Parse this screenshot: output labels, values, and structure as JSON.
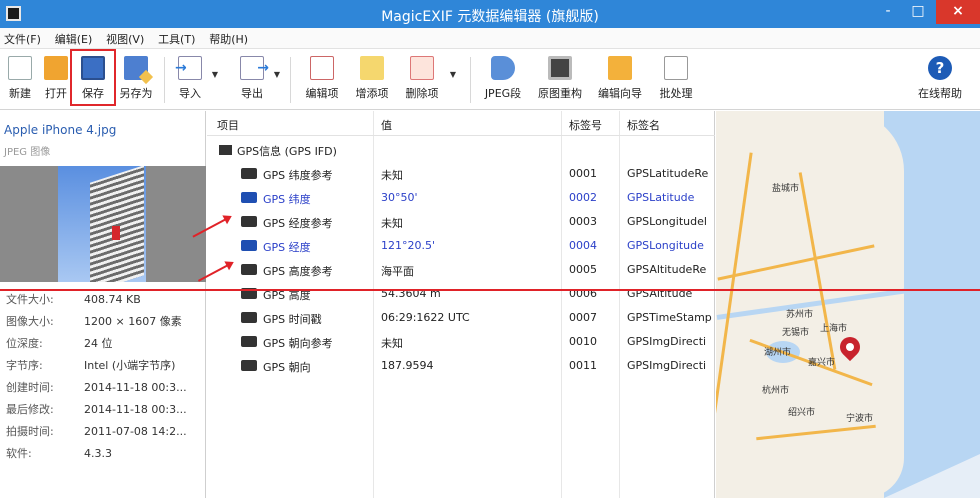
{
  "window": {
    "title": "MagicEXIF 元数据编辑器 (旗舰版)",
    "min": "-",
    "max": "□",
    "close": "×"
  },
  "menu": [
    "文件(F)",
    "编辑(E)",
    "视图(V)",
    "工具(T)",
    "帮助(H)"
  ],
  "toolbar": {
    "new": "新建",
    "open": "打开",
    "save": "保存",
    "saveas": "另存为",
    "import": "导入",
    "export": "导出",
    "edit": "编辑项",
    "add": "增添项",
    "delete": "删除项",
    "jpeg": "JPEG段",
    "raw": "原图重构",
    "wizard": "编辑向导",
    "batch": "批处理",
    "help": "在线帮助",
    "help_glyph": "?"
  },
  "file": {
    "name": "Apple iPhone 4.jpg",
    "type": "JPEG 图像",
    "props": [
      {
        "k": "文件大小:",
        "v": "408.74 KB"
      },
      {
        "k": "图像大小:",
        "v": "1200 × 1607 像素"
      },
      {
        "k": "位深度:",
        "v": "24 位"
      },
      {
        "k": "字节序:",
        "v": "Intel (小端字节序)"
      },
      {
        "k": "创建时间:",
        "v": "2014-11-18 00:3..."
      },
      {
        "k": "最后修改:",
        "v": "2014-11-18 00:3..."
      },
      {
        "k": "拍摄时间:",
        "v": "2011-07-08 14:2..."
      },
      {
        "k": "软件:",
        "v": "4.3.3"
      }
    ]
  },
  "table": {
    "headers": [
      "项目",
      "值",
      "标签号",
      "标签名"
    ],
    "group": "GPS信息 (GPS IFD)",
    "rows": [
      {
        "name": "GPS 纬度参考",
        "value": "未知",
        "tag": "0001",
        "tagname": "GPSLatitudeRe"
      },
      {
        "name": "GPS 纬度",
        "value": "30°50'",
        "tag": "0002",
        "tagname": "GPSLatitude"
      },
      {
        "name": "GPS 经度参考",
        "value": "未知",
        "tag": "0003",
        "tagname": "GPSLongitudel"
      },
      {
        "name": "GPS 经度",
        "value": "121°20.5'",
        "tag": "0004",
        "tagname": "GPSLongitude"
      },
      {
        "name": "GPS 高度参考",
        "value": "海平面",
        "tag": "0005",
        "tagname": "GPSAltitudeRe"
      },
      {
        "name": "GPS 高度",
        "value": "54.3604 m",
        "tag": "0006",
        "tagname": "GPSAltitude"
      },
      {
        "name": "GPS 时间戳",
        "value": "06:29:1622 UTC",
        "tag": "0007",
        "tagname": "GPSTimeStamp"
      },
      {
        "name": "GPS 朝向参考",
        "value": "未知",
        "tag": "0010",
        "tagname": "GPSImgDirecti"
      },
      {
        "name": "GPS 朝向",
        "value": "187.9594",
        "tag": "0011",
        "tagname": "GPSImgDirecti"
      }
    ]
  },
  "map": {
    "cities": [
      "盐城市",
      "上海市",
      "湖州市",
      "嘉兴市",
      "杭州市",
      "宁波市",
      "绍兴市",
      "无锡市",
      "苏州市"
    ]
  },
  "colors": {
    "accent": "#2f86d8",
    "highlight": "#e0272b",
    "selected_text": "#2a3fc8"
  }
}
